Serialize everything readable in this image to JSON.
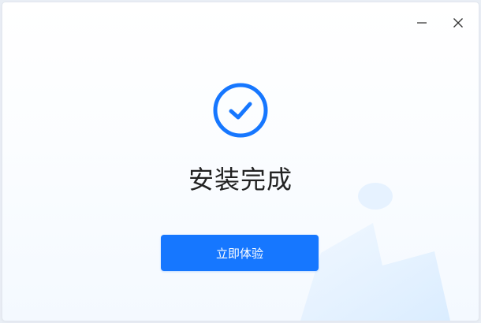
{
  "window": {
    "controls": {
      "minimize_icon": "minimize-icon",
      "close_icon": "close-icon"
    }
  },
  "status": {
    "icon": "check-circle-icon",
    "title": "安装完成",
    "accent_color": "#1677ff"
  },
  "actions": {
    "primary_label": "立即体验"
  }
}
